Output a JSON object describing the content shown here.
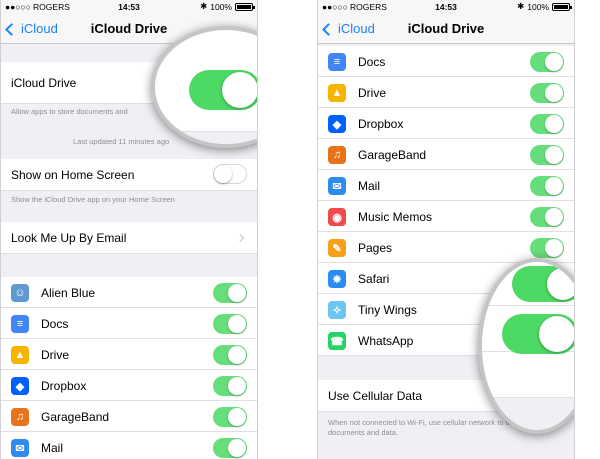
{
  "status_bar": {
    "carrier": "●●○○○ ROGERS",
    "wifi": "◐",
    "time": "14:53",
    "location": "➤",
    "bluetooth": "✱",
    "battery": "100%"
  },
  "left": {
    "nav": {
      "back": "iCloud",
      "title": "iCloud Drive"
    },
    "icloud_drive": {
      "label": "iCloud Drive",
      "enabled": true,
      "note": "Allow apps to store documents and",
      "last_updated": "Last updated 11 minutes ago"
    },
    "show_home": {
      "label": "Show on Home Screen",
      "enabled": false,
      "note": "Show the iCloud Drive app on your Home Screen"
    },
    "look_me_up": {
      "label": "Look Me Up By Email"
    },
    "apps": [
      {
        "name": "Alien Blue",
        "icon": "reddit-alien-icon",
        "on": true
      },
      {
        "name": "Docs",
        "icon": "docs-icon",
        "on": true
      },
      {
        "name": "Drive",
        "icon": "drive-icon",
        "on": true
      },
      {
        "name": "Dropbox",
        "icon": "dropbox-icon",
        "on": true
      },
      {
        "name": "GarageBand",
        "icon": "guitar-icon",
        "on": true
      },
      {
        "name": "Mail",
        "icon": "mail-icon",
        "on": true
      }
    ]
  },
  "right": {
    "nav": {
      "back": "iCloud",
      "title": "iCloud Drive"
    },
    "apps": [
      {
        "name": "Docs",
        "icon": "docs-icon",
        "on": true
      },
      {
        "name": "Drive",
        "icon": "drive-icon",
        "on": true
      },
      {
        "name": "Dropbox",
        "icon": "dropbox-icon",
        "on": true
      },
      {
        "name": "GarageBand",
        "icon": "guitar-icon",
        "on": true
      },
      {
        "name": "Mail",
        "icon": "mail-icon",
        "on": true
      },
      {
        "name": "Music Memos",
        "icon": "music-memos-icon",
        "on": true
      },
      {
        "name": "Pages",
        "icon": "pages-icon",
        "on": true
      },
      {
        "name": "Safari",
        "icon": "compass-icon",
        "on": true
      },
      {
        "name": "Tiny Wings",
        "icon": "bird-icon",
        "on": true
      },
      {
        "name": "WhatsApp",
        "icon": "whatsapp-icon",
        "on": true
      }
    ],
    "cellular": {
      "label": "Use Cellular Data",
      "note": "When not connected to Wi-Fi, use cellular network to transfer documents and data."
    }
  },
  "colors": {
    "accent": "#1a82fb",
    "toggle_on": "#4cd964",
    "background": "#efeff4"
  }
}
